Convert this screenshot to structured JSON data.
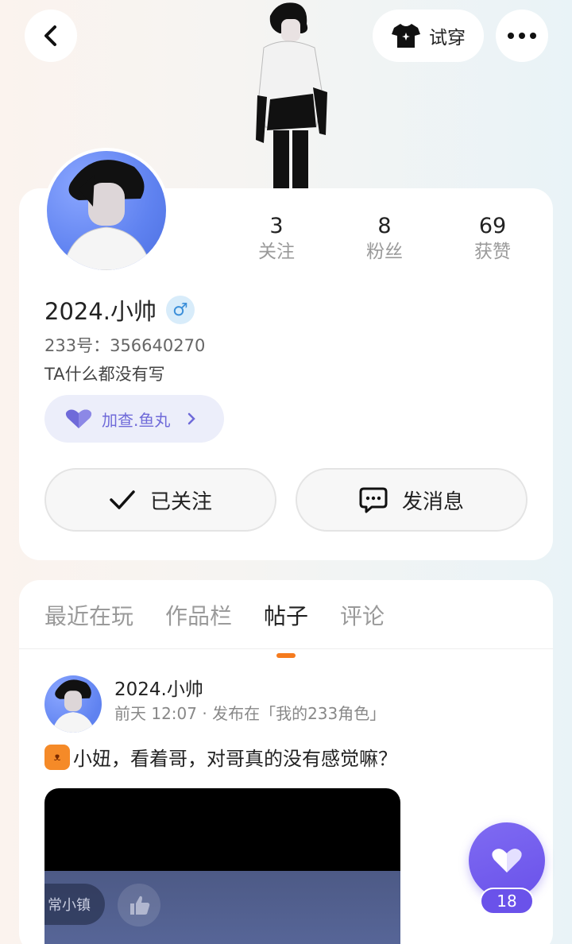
{
  "header": {
    "tryon_label": "试穿"
  },
  "stats": [
    {
      "num": "3",
      "label": "关注"
    },
    {
      "num": "8",
      "label": "粉丝"
    },
    {
      "num": "69",
      "label": "获赞"
    }
  ],
  "profile": {
    "username": "2024.小帅",
    "gender": "♂",
    "uid": "233号：356640270",
    "bio": "TA什么都没有写",
    "group_label": "加查.鱼丸",
    "follow_label": "已关注",
    "message_label": "发消息"
  },
  "tabs": [
    "最近在玩",
    "作品栏",
    "帖子",
    "评论"
  ],
  "post": {
    "author": "2024.小帅",
    "meta": "前天 12:07 · 发布在「我的233角色」",
    "text": "小妞，看着哥，对哥真的没有感觉嘛？",
    "media_label": "常小镇"
  },
  "like": {
    "count": "18"
  },
  "colors": {
    "accent": "#6a52ea",
    "tab_indicator": "#f57b1e"
  }
}
